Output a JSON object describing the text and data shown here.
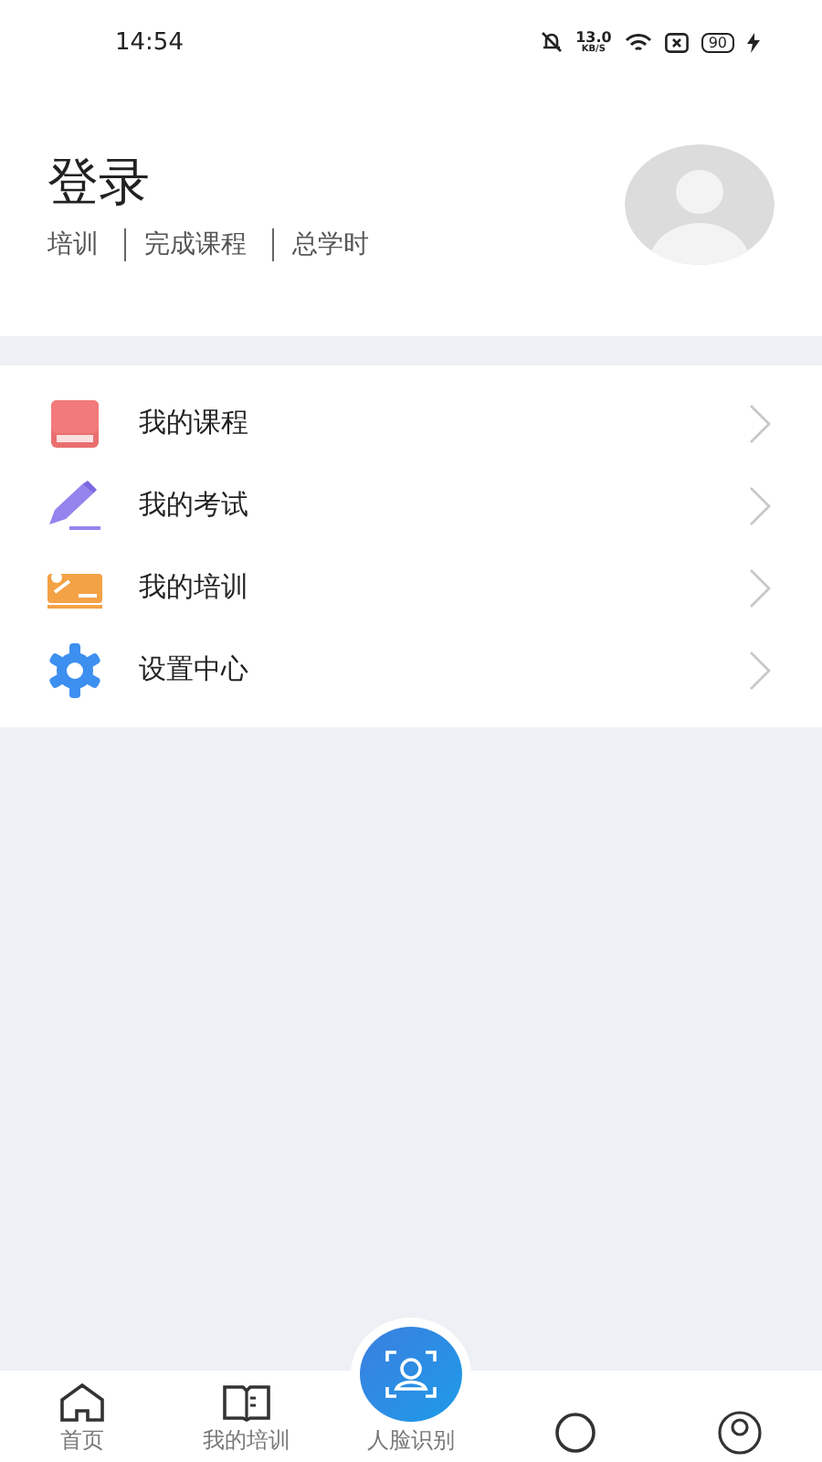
{
  "status_bar": {
    "time": "14:54",
    "network_speed": "13.0",
    "network_unit": "KB/S",
    "battery": "90"
  },
  "profile": {
    "title": "登录",
    "stats": [
      {
        "label": "培训"
      },
      {
        "label": "完成课程"
      },
      {
        "label": "总学时"
      }
    ]
  },
  "menu": [
    {
      "label": "我的课程",
      "kind": "book"
    },
    {
      "label": "我的考试",
      "kind": "pencil"
    },
    {
      "label": "我的培训",
      "kind": "training"
    },
    {
      "label": "设置中心",
      "kind": "gear"
    }
  ],
  "tab_bar": [
    {
      "label": "首页",
      "kind": "home",
      "selected": false
    },
    {
      "label": "我的培训",
      "kind": "book",
      "selected": false
    },
    {
      "label": "人脸识别",
      "kind": "face",
      "selected": false
    },
    {
      "kind": "circle",
      "selected": false
    },
    {
      "kind": "person",
      "selected": false
    }
  ]
}
